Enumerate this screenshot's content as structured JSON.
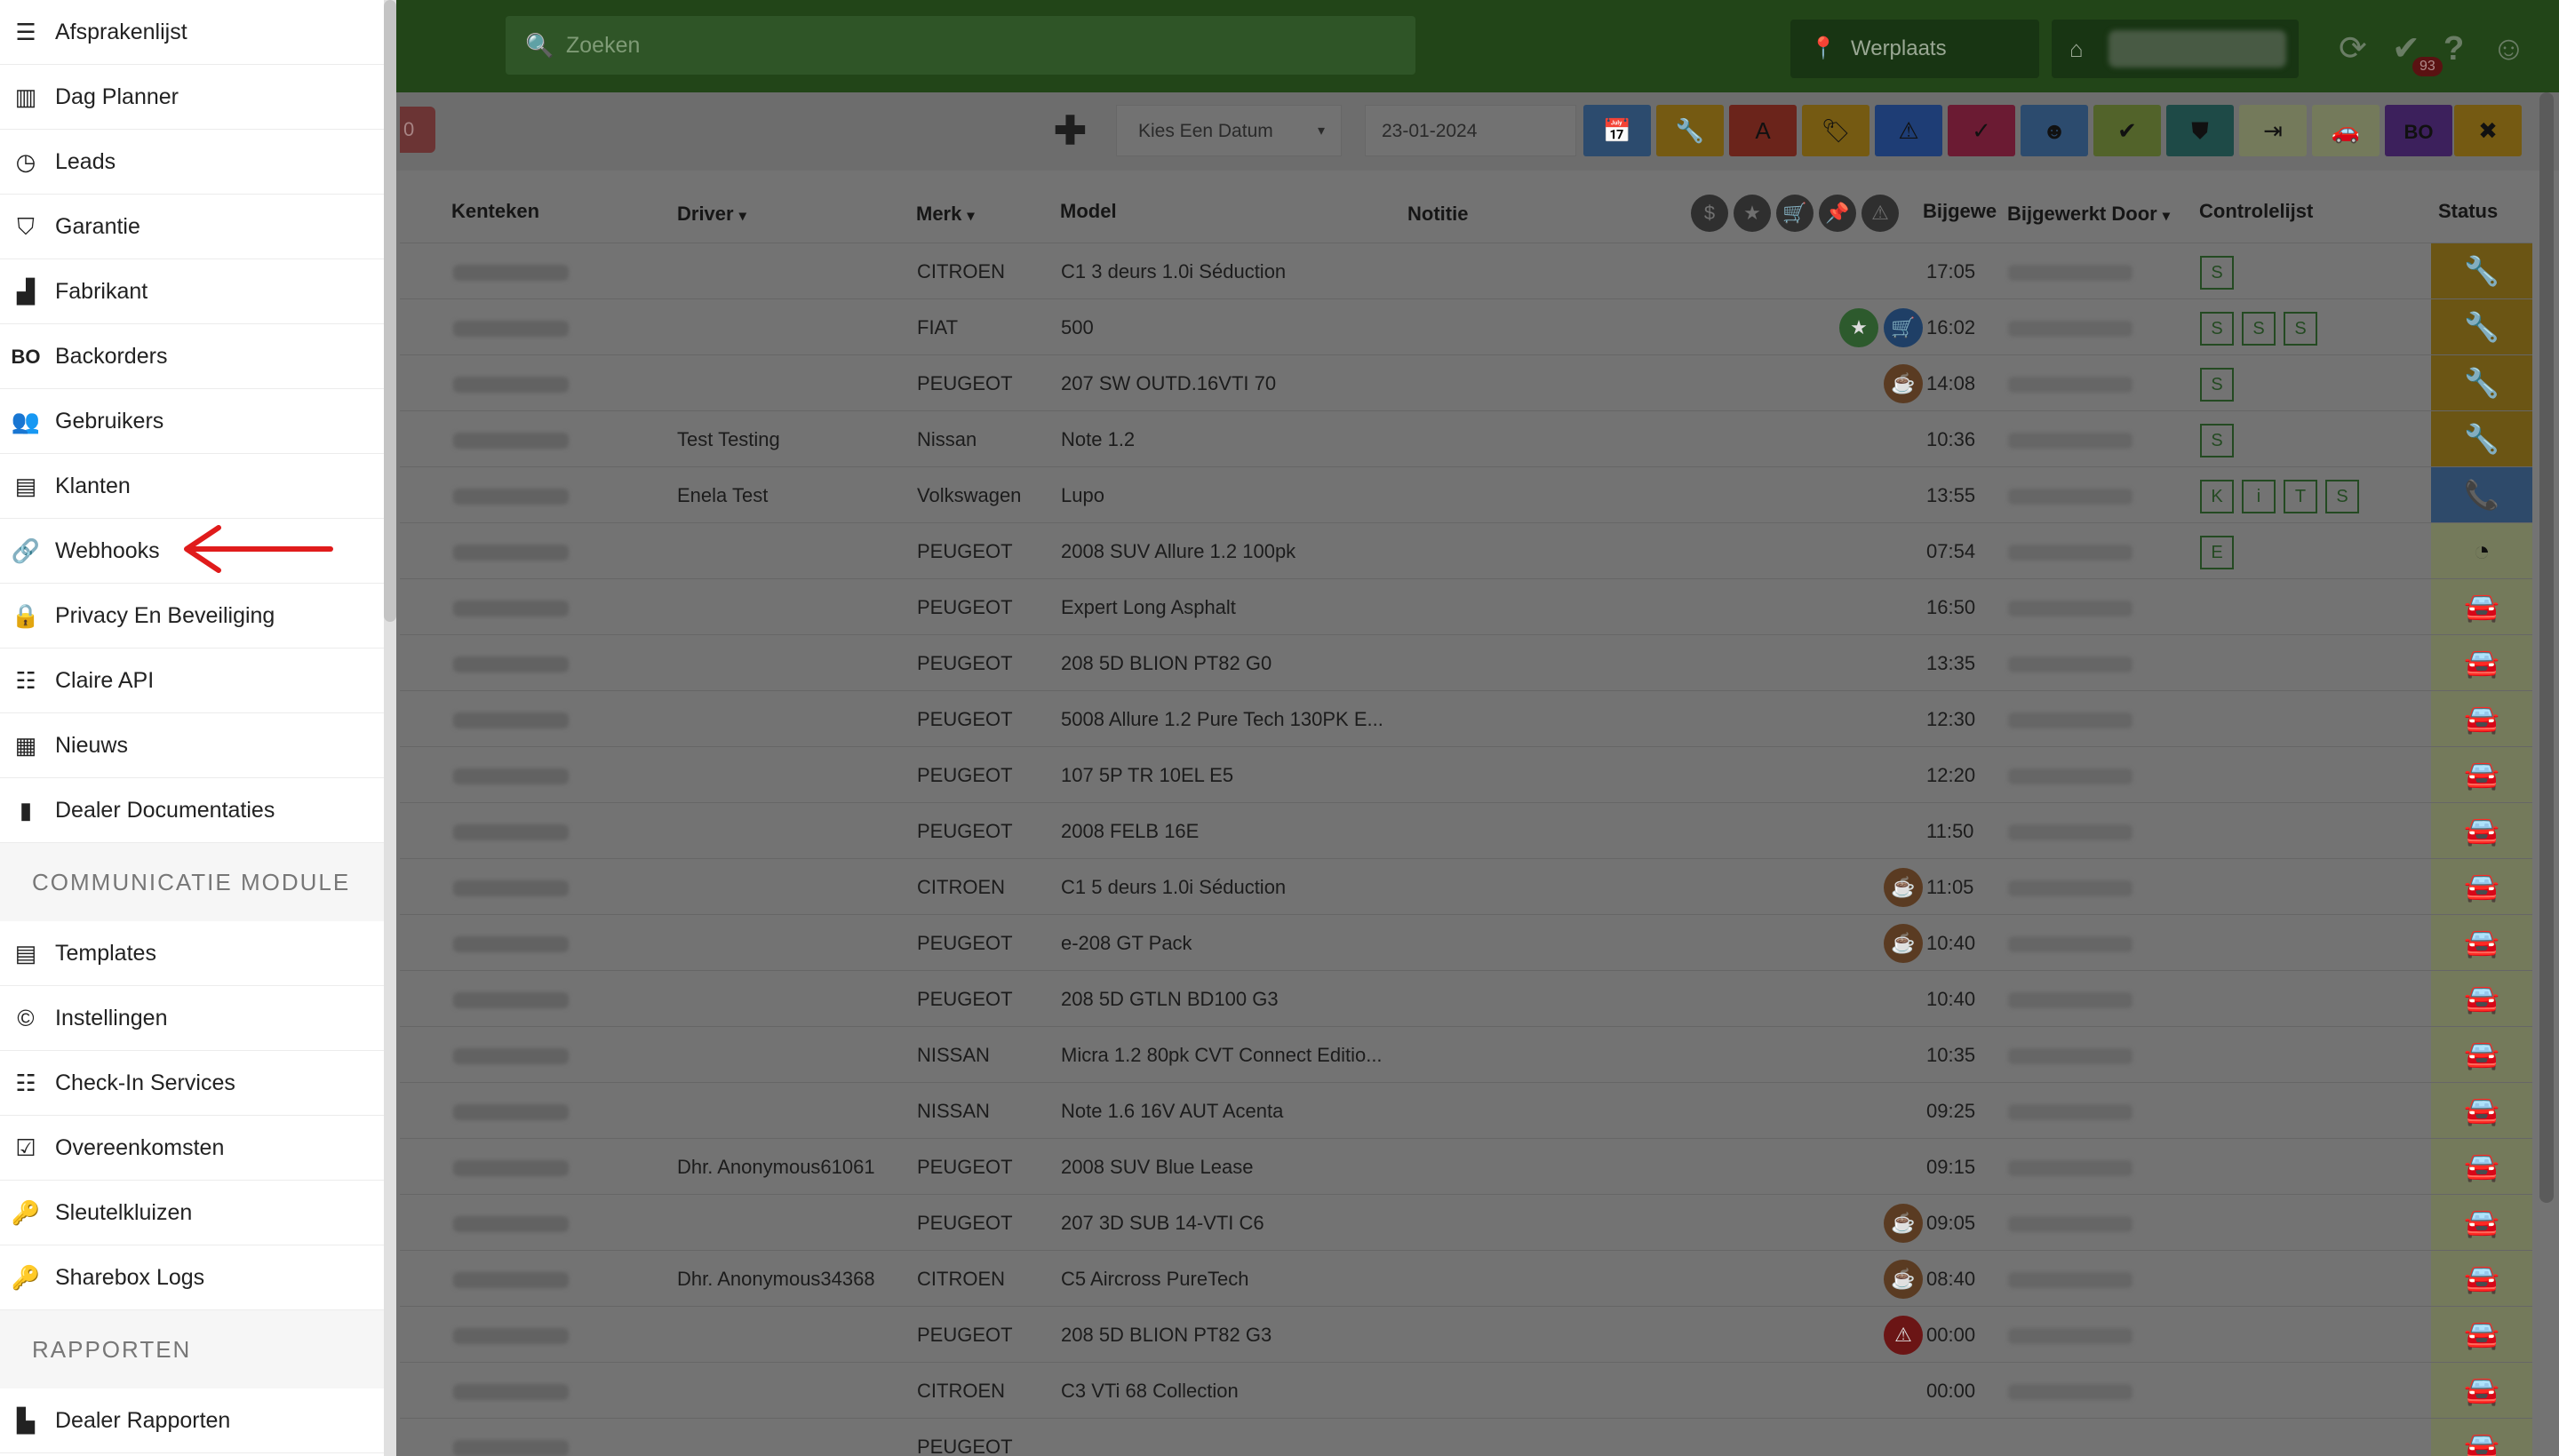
{
  "header": {
    "search_placeholder": "Zoeken",
    "location_label": "Werplaats",
    "notification_count": "93"
  },
  "toolbar": {
    "partial_button_text": "0",
    "date_select_label": "Kies Een Datum",
    "date_value": "23-01-2024",
    "filter_buttons": [
      {
        "name": "calendar",
        "color": "#2c4b6e",
        "glyph": "📅"
      },
      {
        "name": "wrench",
        "color": "#755a12",
        "glyph": "🔧"
      },
      {
        "name": "a-letter",
        "color": "#6b241b",
        "glyph": "A"
      },
      {
        "name": "tag",
        "color": "#755a12",
        "glyph": "🏷"
      },
      {
        "name": "warning",
        "color": "#1e3d75",
        "glyph": "⚠"
      },
      {
        "name": "user-check",
        "color": "#6b1b33",
        "glyph": "✓"
      },
      {
        "name": "smile",
        "color": "#2c4b6e",
        "glyph": "☻"
      },
      {
        "name": "double-check",
        "color": "#52632a",
        "glyph": "✔"
      },
      {
        "name": "shield",
        "color": "#1e4a47",
        "glyph": "⛊"
      },
      {
        "name": "sign-out",
        "color": "#747a5b",
        "glyph": "⇥"
      },
      {
        "name": "car",
        "color": "#747a5b",
        "glyph": "🚗"
      },
      {
        "name": "backorder",
        "color": "#3c205c",
        "glyph": "BO"
      },
      {
        "name": "cancel",
        "color": "#755a12",
        "glyph": "✖"
      }
    ]
  },
  "table": {
    "columns": [
      "Kenteken",
      "Driver",
      "Merk",
      "Model",
      "Notitie",
      "Bijgewe",
      "Bijgewerkt Door",
      "Controlelijst",
      "Status"
    ],
    "rows": [
      {
        "driver": "",
        "merk": "CITROEN",
        "model": "C1 3 deurs 1.0i Séduction",
        "time": "17:05",
        "checks": [
          "S"
        ],
        "status": "wrench",
        "icons": []
      },
      {
        "driver": "",
        "merk": "FIAT",
        "model": "500",
        "time": "16:02",
        "checks": [
          "S",
          "S",
          "S"
        ],
        "status": "wrench",
        "icons": [
          "star",
          "cart"
        ]
      },
      {
        "driver": "",
        "merk": "PEUGEOT",
        "model": "207 SW OUTD.16VTI 70",
        "time": "14:08",
        "checks": [
          "S"
        ],
        "status": "wrench",
        "icons": [
          "coffee"
        ]
      },
      {
        "driver": "Test Testing",
        "merk": "Nissan",
        "model": "Note 1.2",
        "time": "10:36",
        "checks": [
          "S"
        ],
        "status": "wrench",
        "icons": []
      },
      {
        "driver": "Enela Test",
        "merk": "Volkswagen",
        "model": "Lupo",
        "time": "13:55",
        "checks": [
          "K",
          "i",
          "T",
          "S"
        ],
        "status": "phone",
        "icons": []
      },
      {
        "driver": "",
        "merk": "PEUGEOT",
        "model": "2008 SUV Allure 1.2 100pk",
        "time": "07:54",
        "checks": [
          "E"
        ],
        "status": "clock",
        "icons": []
      },
      {
        "driver": "",
        "merk": "PEUGEOT",
        "model": "Expert Long Asphalt",
        "time": "16:50",
        "checks": [],
        "status": "car",
        "icons": []
      },
      {
        "driver": "",
        "merk": "PEUGEOT",
        "model": "208 5D BLION PT82 G0",
        "time": "13:35",
        "checks": [],
        "status": "car",
        "icons": []
      },
      {
        "driver": "",
        "merk": "PEUGEOT",
        "model": "5008 Allure 1.2 Pure Tech 130PK E...",
        "time": "12:30",
        "checks": [],
        "status": "car",
        "icons": []
      },
      {
        "driver": "",
        "merk": "PEUGEOT",
        "model": "107 5P TR 10EL E5",
        "time": "12:20",
        "checks": [],
        "status": "car",
        "icons": []
      },
      {
        "driver": "",
        "merk": "PEUGEOT",
        "model": "2008 FELB 16E",
        "time": "11:50",
        "checks": [],
        "status": "car",
        "icons": []
      },
      {
        "driver": "",
        "merk": "CITROEN",
        "model": "C1 5 deurs 1.0i Séduction",
        "time": "11:05",
        "checks": [],
        "status": "car",
        "icons": [
          "coffee"
        ]
      },
      {
        "driver": "",
        "merk": "PEUGEOT",
        "model": "e-208 GT Pack",
        "time": "10:40",
        "checks": [],
        "status": "car",
        "icons": [
          "coffee"
        ]
      },
      {
        "driver": "",
        "merk": "PEUGEOT",
        "model": "208 5D GTLN BD100 G3",
        "time": "10:40",
        "checks": [],
        "status": "car",
        "icons": []
      },
      {
        "driver": "",
        "merk": "NISSAN",
        "model": "Micra 1.2 80pk CVT Connect Editio...",
        "time": "10:35",
        "checks": [],
        "status": "car",
        "icons": []
      },
      {
        "driver": "",
        "merk": "NISSAN",
        "model": "Note 1.6 16V AUT Acenta",
        "time": "09:25",
        "checks": [],
        "status": "car",
        "icons": []
      },
      {
        "driver": "Dhr. Anonymous61061",
        "merk": "PEUGEOT",
        "model": "2008 SUV Blue Lease",
        "time": "09:15",
        "checks": [],
        "status": "car",
        "icons": []
      },
      {
        "driver": "",
        "merk": "PEUGEOT",
        "model": "207 3D SUB 14-VTI C6",
        "time": "09:05",
        "checks": [],
        "status": "car",
        "icons": [
          "coffee"
        ]
      },
      {
        "driver": "Dhr. Anonymous34368",
        "merk": "CITROEN",
        "model": "C5 Aircross PureTech",
        "time": "08:40",
        "checks": [],
        "status": "car",
        "icons": [
          "coffee"
        ]
      },
      {
        "driver": "",
        "merk": "PEUGEOT",
        "model": "208 5D BLION PT82 G3",
        "time": "00:00",
        "checks": [],
        "status": "car",
        "icons": [
          "warning"
        ]
      },
      {
        "driver": "",
        "merk": "CITROEN",
        "model": "C3 VTi 68 Collection",
        "time": "00:00",
        "checks": [],
        "status": "car",
        "icons": []
      },
      {
        "driver": "",
        "merk": "PEUGEOT",
        "model": "",
        "time": "",
        "checks": [],
        "status": "car",
        "icons": []
      }
    ]
  },
  "sidebar": {
    "items": [
      {
        "label": "Afsprakenlijst",
        "icon": "list-icon",
        "glyph": "☰"
      },
      {
        "label": "Dag Planner",
        "icon": "columns-icon",
        "glyph": "▥"
      },
      {
        "label": "Leads",
        "icon": "clock-icon",
        "glyph": "◷"
      },
      {
        "label": "Garantie",
        "icon": "shield-icon",
        "glyph": "⛉"
      },
      {
        "label": "Fabrikant",
        "icon": "factory-icon",
        "glyph": "▟"
      },
      {
        "label": "Backorders",
        "icon": "bo-icon",
        "glyph": "BO"
      },
      {
        "label": "Gebruikers",
        "icon": "users-icon",
        "glyph": "👥"
      },
      {
        "label": "Klanten",
        "icon": "id-card-icon",
        "glyph": "▤"
      },
      {
        "label": "Webhooks",
        "icon": "link-icon",
        "glyph": "🔗"
      },
      {
        "label": "Privacy En Beveiliging",
        "icon": "lock-icon",
        "glyph": "🔒"
      },
      {
        "label": "Claire API",
        "icon": "server-icon",
        "glyph": "☷"
      },
      {
        "label": "Nieuws",
        "icon": "newspaper-icon",
        "glyph": "▦"
      },
      {
        "label": "Dealer Documentaties",
        "icon": "file-icon",
        "glyph": "▮"
      }
    ],
    "section_communicatie": "COMMUNICATIE MODULE",
    "communicatie_items": [
      {
        "label": "Templates",
        "icon": "film-icon",
        "glyph": "▤"
      },
      {
        "label": "Instellingen",
        "icon": "copyright-icon",
        "glyph": "©"
      },
      {
        "label": "Check-In Services",
        "icon": "th-list-icon",
        "glyph": "☷"
      },
      {
        "label": "Overeenkomsten",
        "icon": "check-square-icon",
        "glyph": "☑"
      },
      {
        "label": "Sleutelkluizen",
        "icon": "key-icon",
        "glyph": "🔑"
      },
      {
        "label": "Sharebox Logs",
        "icon": "key-icon",
        "glyph": "🔑"
      }
    ],
    "section_rapporten": "RAPPORTEN",
    "rapporten_items": [
      {
        "label": "Dealer Rapporten",
        "icon": "chart-icon",
        "glyph": "▙"
      }
    ]
  },
  "colors": {
    "annotation_arrow": "#e01b1b",
    "status_wrench": "#6b5514",
    "status_phone": "#2e4a6a",
    "status_car": "#727a55"
  }
}
